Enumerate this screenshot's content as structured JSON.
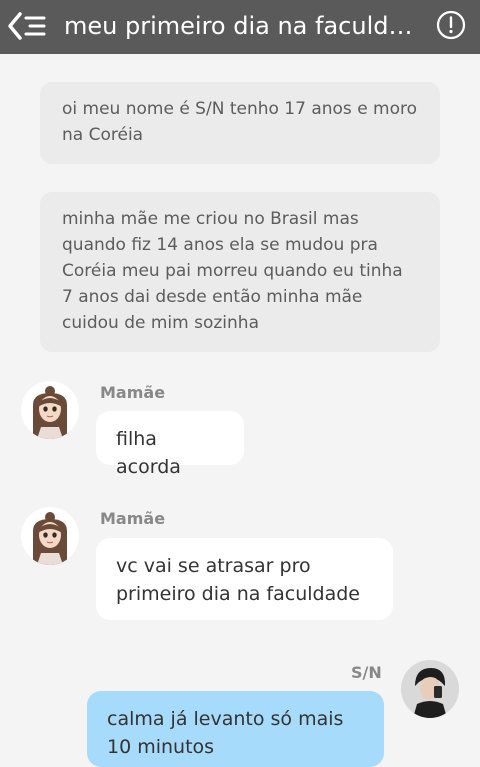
{
  "header": {
    "title": "meu primeiro dia na faculda...",
    "back_icon": "back-list-icon",
    "info_icon": "info-icon"
  },
  "colors": {
    "header_bg": "#5a5a5a",
    "page_bg": "#f4f4f4",
    "narration_bg": "#ebebeb",
    "incoming_bubble": "#ffffff",
    "outgoing_bubble": "#a7dbfb"
  },
  "narrations": [
    "oi meu nome é S/N tenho 17 anos e moro na Coréia",
    "minha mãe me criou no Brasil mas quando fiz 14 anos ela se mudou pra Coréia meu pai morreu quando eu tinha 7 anos dai desde então minha mãe cuidou de mim sozinha"
  ],
  "messages": [
    {
      "sender": "Mamãe",
      "text": "filha acorda",
      "side": "left"
    },
    {
      "sender": "Mamãe",
      "text": "vc vai se atrasar pro primeiro dia na faculdade",
      "side": "left"
    },
    {
      "sender": "S/N",
      "text": "calma já levanto só mais 10 minutos",
      "side": "right"
    }
  ]
}
